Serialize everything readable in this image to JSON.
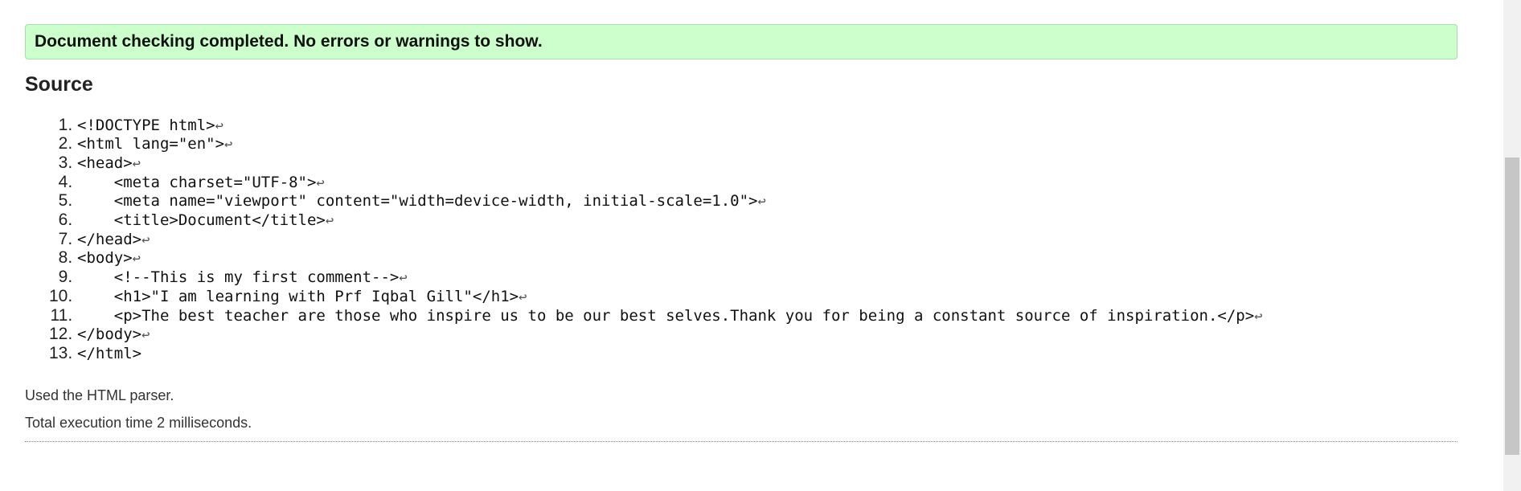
{
  "banner": {
    "message": "Document checking completed. No errors or warnings to show."
  },
  "source": {
    "heading": "Source",
    "eol_glyph": "↩",
    "lines": [
      {
        "text": "<!DOCTYPE html>",
        "eol": true
      },
      {
        "text": "<html lang=\"en\">",
        "eol": true
      },
      {
        "text": "<head>",
        "eol": true
      },
      {
        "text": "    <meta charset=\"UTF-8\">",
        "eol": true
      },
      {
        "text": "    <meta name=\"viewport\" content=\"width=device-width, initial-scale=1.0\">",
        "eol": true
      },
      {
        "text": "    <title>Document</title>",
        "eol": true
      },
      {
        "text": "</head>",
        "eol": true
      },
      {
        "text": "<body>",
        "eol": true
      },
      {
        "text": "    <!--This is my first comment-->",
        "eol": true
      },
      {
        "text": "    <h1>\"I am learning with Prf Iqbal Gill\"</h1>",
        "eol": true
      },
      {
        "text": "    <p>The best teacher are those who inspire us to be our best selves.Thank you for being a constant source of inspiration.</p>",
        "eol": true
      },
      {
        "text": "</body>",
        "eol": true
      },
      {
        "text": "</html>",
        "eol": false
      }
    ]
  },
  "footer": {
    "parser_note": "Used the HTML parser.",
    "execution_time": "Total execution time 2 milliseconds."
  }
}
